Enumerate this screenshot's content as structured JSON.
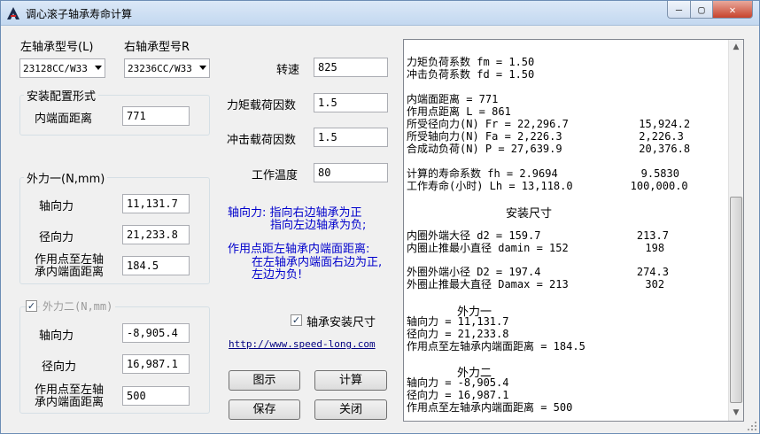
{
  "window": {
    "title": "调心滚子轴承寿命计算",
    "minimize_glyph": "—",
    "maximize_glyph": "▢",
    "close_glyph": "✕"
  },
  "left_bearing": {
    "label": "左轴承型号(L)",
    "value": "23128CC/W33"
  },
  "right_bearing": {
    "label": "右轴承型号R",
    "value": "23236CC/W33"
  },
  "install": {
    "group_label": "安装配置形式",
    "inner_distance_label": "内端面距离",
    "inner_distance_value": "771"
  },
  "params": {
    "speed_label": "转速",
    "speed_value": "825",
    "moment_factor_label": "力矩载荷因数",
    "moment_factor_value": "1.5",
    "impact_factor_label": "冲击载荷因数",
    "impact_factor_value": "1.5",
    "temp_label": "工作温度",
    "temp_value": "80"
  },
  "force1": {
    "group_label": "外力一(N,mm)",
    "axial_label": "轴向力",
    "axial_value": "11,131.7",
    "radial_label": "径向力",
    "radial_value": "21,233.8",
    "point_label_1": "作用点至左轴",
    "point_label_2": "承内端面距离",
    "point_value": "184.5"
  },
  "force2": {
    "group_label": "外力二(N,mm)",
    "checked": "✓",
    "axial_label": "轴向力",
    "axial_value": "-8,905.4",
    "radial_label": "径向力",
    "radial_value": "16,987.1",
    "point_label_1": "作用点至左轴",
    "point_label_2": "承内端面距离",
    "point_value": "500"
  },
  "notes": {
    "axial_note_1": "轴向力: 指向右边轴承为正",
    "axial_note_2": "指向左边轴承为负;",
    "point_note_1": "作用点距左轴承内端面距离:",
    "point_note_2": "在左轴承内端面右边为正,",
    "point_note_3": "左边为负!"
  },
  "install_size_check": {
    "checked": "✓",
    "label": "轴承安装尺寸"
  },
  "link": "http://www.speed-long.com",
  "buttons": {
    "diagram": "图示",
    "calculate": "计算",
    "save": "保存",
    "close": "关闭"
  },
  "output": {
    "lines": [
      "力矩负荷系数 fm = 1.50",
      "冲击负荷系数 fd = 1.50",
      "",
      "内端面距离 = 771",
      "作用点距离 L = 861",
      "所受径向力(N) Fr = 22,296.7           15,924.2",
      "所受轴向力(N) Fa = 2,226.3            2,226.3",
      "合成动负荷(N) P = 27,639.9            20,376.8",
      "",
      "计算的寿命系数 fh = 2.9694             9.5830",
      "工作寿命(小时) Lh = 13,118.0         100,000.0"
    ],
    "mount_heading": "安装尺寸",
    "mount_lines": [
      "内圈外端大径 d2 = 159.7               213.7",
      "内圈止推最小直径 damin = 152            198",
      "",
      "外圈外端小径 D2 = 197.4               274.3",
      "外圈止推最大直径 Damax = 213            302"
    ],
    "force1_heading": "外力一",
    "force1_lines": [
      "轴向力 = 11,131.7",
      "径向力 = 21,233.8",
      "作用点至左轴承内端面距离 = 184.5"
    ],
    "force2_heading": "外力二",
    "force2_lines": [
      "轴向力 = -8,905.4",
      "径向力 = 16,987.1",
      "作用点至左轴承内端面距离 = 500"
    ],
    "scroll_up": "▲",
    "scroll_down": "▼"
  }
}
